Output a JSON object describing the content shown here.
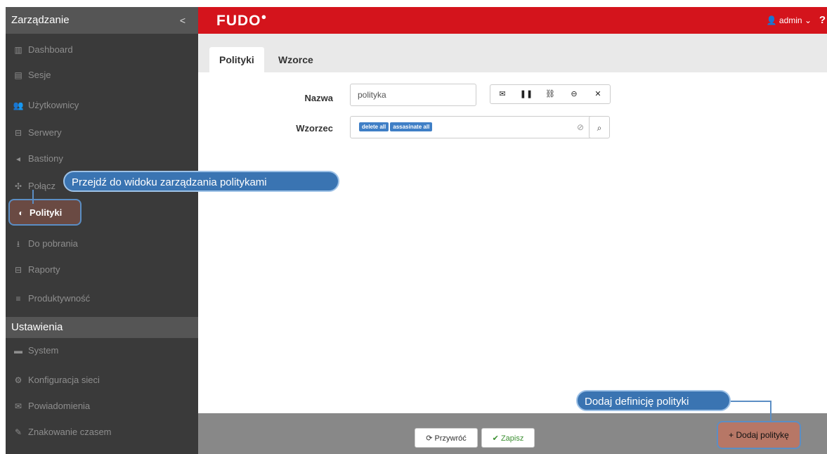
{
  "sidebar": {
    "header": "Zarządzanie",
    "collapse_icon": "chevron-left-icon",
    "items": [
      {
        "label": "Dashboard",
        "icon": "▥"
      },
      {
        "label": "Sesje",
        "icon": "▤"
      },
      {
        "label": "Użytkownicy",
        "icon": "👥"
      },
      {
        "label": "Serwery",
        "icon": "⊟"
      },
      {
        "label": "Bastiony",
        "icon": "◂"
      },
      {
        "label": "Połącz",
        "icon": "✣"
      },
      {
        "label": "Polityki",
        "icon": "◐"
      },
      {
        "label": "Do pobrania",
        "icon": "⭳"
      },
      {
        "label": "Raporty",
        "icon": "⊟"
      },
      {
        "label": "Produktywność",
        "icon": "≡"
      }
    ],
    "section_title": "Ustawienia",
    "settings": [
      {
        "label": "System",
        "icon": "▬"
      },
      {
        "label": "Konfiguracja sieci",
        "icon": "⚙"
      },
      {
        "label": "Powiadomienia",
        "icon": "✉"
      },
      {
        "label": "Znakowanie czasem",
        "icon": "✎"
      }
    ]
  },
  "topbar": {
    "logo": "FUDO",
    "user": "admin",
    "help": "?"
  },
  "tabs": [
    {
      "label": "Polityki"
    },
    {
      "label": "Wzorce"
    }
  ],
  "form": {
    "name_label": "Nazwa",
    "name_value": "polityka",
    "pattern_label": "Wzorzec",
    "tags": [
      "delete all",
      "assasinate all"
    ]
  },
  "footer": {
    "restore": "Przywróć",
    "save": "Zapisz",
    "add": "Dodaj politykę"
  },
  "callouts": {
    "policies": "Przejdź do widoku zarządzania politykami",
    "add": "Dodaj definicję polityki"
  }
}
